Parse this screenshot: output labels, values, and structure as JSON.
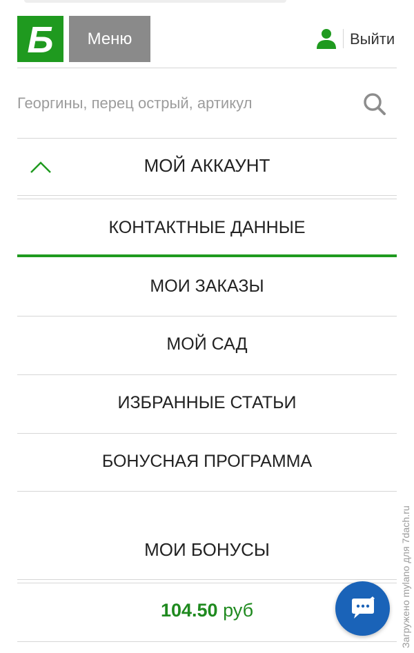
{
  "header": {
    "logo_letter": "Б",
    "menu_label": "Меню",
    "logout_label": "Выйти"
  },
  "search": {
    "placeholder": "Георгины, перец острый, артикул"
  },
  "account": {
    "title": "МОЙ АККАУНТ",
    "items": [
      {
        "label": "КОНТАКТНЫЕ ДАННЫЕ",
        "active": true
      },
      {
        "label": "МОИ ЗАКАЗЫ"
      },
      {
        "label": "МОЙ САД"
      },
      {
        "label": "ИЗБРАННЫЕ СТАТЬИ"
      },
      {
        "label": "БОНУСНАЯ ПРОГРАММА"
      }
    ]
  },
  "bonuses": {
    "title": "МОИ БОНУСЫ",
    "amount": "104.50",
    "currency": "руб"
  },
  "watermark": "Загружено mylano для 7dach.ru",
  "colors": {
    "brand_green": "#1f9a1f",
    "menu_gray": "#8a8a8a",
    "chat_blue": "#1a63b8"
  },
  "icons": {
    "logo": "logo-icon",
    "user": "user-icon",
    "search": "search-icon",
    "collapse": "chevron-up-icon",
    "chat": "chat-bubble-icon"
  }
}
